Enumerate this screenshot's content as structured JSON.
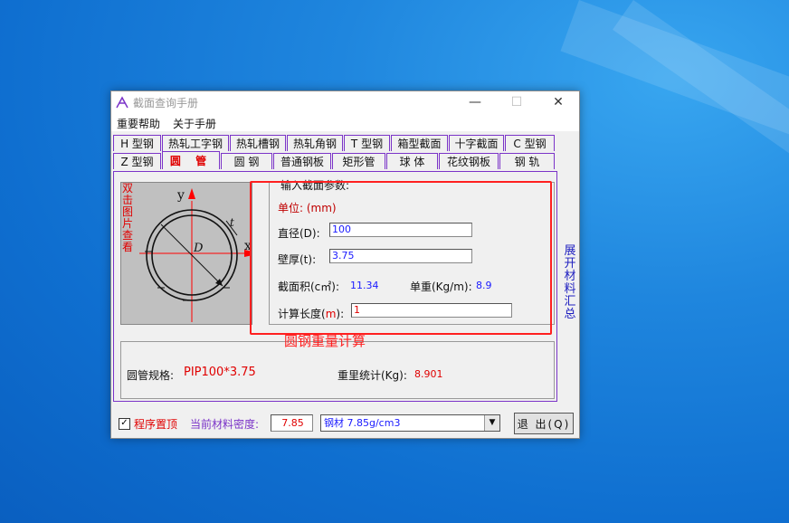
{
  "window": {
    "title": "截面查询手册",
    "minimize": "—",
    "maximize": "☐",
    "close": "✕"
  },
  "menu": [
    "重要帮助",
    "关于手册"
  ],
  "tabs_row1": [
    "H 型钢",
    "热轧工字钢",
    "热轧槽钢",
    "热轧角钢",
    "T 型钢",
    "箱型截面",
    "十字截面",
    "C 型钢"
  ],
  "tabs_row2": [
    "Z 型钢",
    "圆 管",
    "圆 钢",
    "普通钢板",
    "矩形管",
    "球 体",
    "花纹钢板",
    "钢 轨"
  ],
  "active_tab": "圆 管",
  "figure": {
    "note": "双击图片查看",
    "axis_y": "y",
    "axis_x": "x",
    "label_d": "D",
    "label_t": "t"
  },
  "params": {
    "title": "输入截面参数:",
    "unit": "单位: (mm)",
    "diameter_label": "直径(D):",
    "diameter_value": "100",
    "thickness_label": "壁厚(t):",
    "thickness_value": "3.75",
    "area_label": "截面积(c㎡):",
    "area_value": "11.34",
    "unit_weight_label": "单重(Kg/m):",
    "unit_weight_value": "8.9",
    "length_label_a": "计算长度(",
    "length_label_m": "m",
    "length_label_b": "):",
    "length_value": "1"
  },
  "result": {
    "spec_label": "圆管规格:",
    "spec_value": "PIP100*3.75",
    "total_label": "重里统计(Kg):",
    "total_value": "8.901"
  },
  "side_button": "展开材料汇总",
  "annotation": "圆钢重量计算",
  "bottom": {
    "topmost_label": "程序置顶",
    "topmost_checked": "✓",
    "density_label": "当前材料密度:",
    "density_value": "7.85",
    "material_value": "钢材 7.85g/cm3",
    "dropdown_arrow": "▼",
    "exit_label": "退 出(Q)"
  },
  "colors": {
    "accent_purple": "#7b34c8",
    "alert_red": "#ff2020",
    "value_blue": "#1a1aff"
  }
}
